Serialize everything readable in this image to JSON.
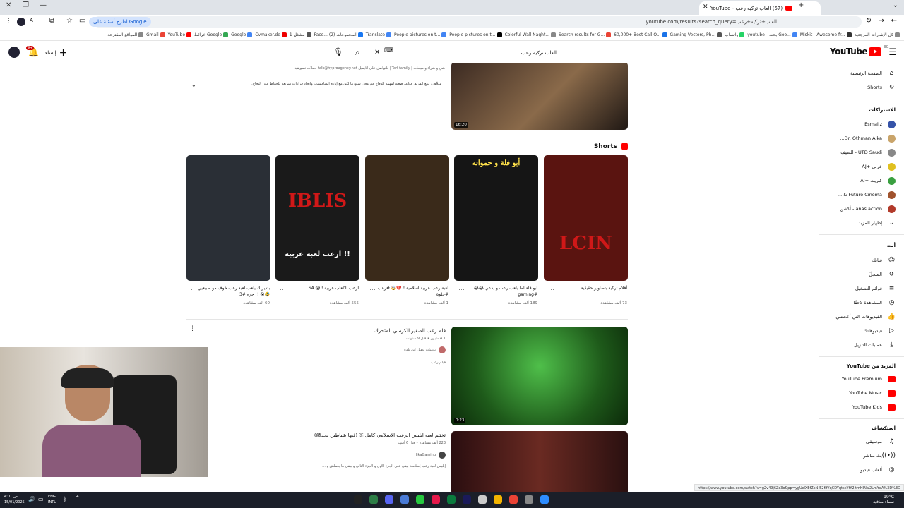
{
  "browser": {
    "tab_title": "(57) العاب تركيه رعب - YouTube",
    "url": "youtube.com/results?search_query=العاب+تركيه+رعب",
    "google_chip": "اطرح أسئلة على Google",
    "bookmarks": [
      "كل الإشارات المرجعية",
      "Miskit - Awesome fr...",
      "youtube - بحث Goo...",
      "واتساب",
      "Gaming Vectors, Ph...",
      "60,000+ Best Call O...",
      "Search results for G...",
      "Colorful Wall Naght...",
      "People pictures on t...",
      "People pictures on t...",
      "Translate",
      "Face... (2) المجموعات",
      "مشغل 1",
      "Cvmaker.de",
      "Google",
      "خرائط Google",
      "YouTube",
      "Gmail",
      "المواقع المقترحة"
    ]
  },
  "header": {
    "logo_text": "YouTube",
    "logo_region": "EG",
    "search_value": "العاب تركيه رعب",
    "create_label": "إنشاء",
    "notif_count": "9+"
  },
  "sidebar": {
    "home": "الصفحة الرئيسية",
    "shorts": "Shorts",
    "subs_header": "الاشتراكات",
    "subs": [
      {
        "name": "Esmailz",
        "color": "#3553a8"
      },
      {
        "name": "Dr. Othman Alka...",
        "color": "#c9a46a"
      },
      {
        "name": "UTD Saudi - السيف",
        "color": "#888888"
      },
      {
        "name": "عربي +AJ",
        "color": "#e0c020"
      },
      {
        "name": "كبريت +AJ",
        "color": "#3aa040"
      },
      {
        "name": "Future Cinema & ...",
        "color": "#a0522d"
      },
      {
        "name": "anas action - أكشن",
        "color": "#b23a2a"
      }
    ],
    "show_more": "إظهار المزيد",
    "you_header": "أنت",
    "you_items": [
      "قناتك",
      "السجلّ",
      "قوائم التشغيل",
      "المشاهدة لاحقًا",
      "الفيديوهات التي أعجبتني",
      "فيديوهاتك",
      "عمليات التنزيل"
    ],
    "more_from_header": "المزيد من YouTube",
    "more_from": [
      "YouTube Premium",
      "YouTube Music",
      "YouTube Kids"
    ],
    "explore_header": "استكشاف",
    "explore": [
      "موسيقى",
      "بث مباشر",
      "ألعاب فيديو"
    ]
  },
  "main": {
    "top_video": {
      "desc": "شي و شراء و مبيعات | Tarl family | للتواصل على الايميل talk@hyproagency.net حملات تسويقية",
      "ad_text": "ملخّص: يتبع الفريق قواعد صعبة لمهمة الدفاع في محل شاورما لكن مع إثارة المنافسين، واتخاذ قرارات سريعة للحفاظ على النجاح.",
      "duration": "16:20"
    },
    "shorts_header": "Shorts",
    "shorts": [
      {
        "title": "أفلام تركية بتصاوير حقيقية",
        "views": "73 ألف مشاهدة",
        "bg": "#5a1410",
        "overlay": "LCIN"
      },
      {
        "title": "ابو فلة لما يلعب رعب و يدعي 😂😂 #gaming",
        "views": "189 ألف مشاهدة",
        "bg": "#151515",
        "overlay": "أبو فلة و حمواته"
      },
      {
        "title": "لعبة رعب عربية اسلامية ! 💔🤯 #رعب #حلوة",
        "views": "1 ألف مشاهدة",
        "bg": "#3a2a1a",
        "overlay": ""
      },
      {
        "title": "ارعب الالعاب عربية ! 😱 SA",
        "views": "555 ألف مشاهدة",
        "bg": "#1a1a1a",
        "overlay": "IBLIS"
      },
      {
        "title": "بتديريك يلعب لعبة رعب خوف مو طبيعيي 🤣😰 !! جزء #3",
        "views": "60 ألف مشاهدة",
        "bg": "#2a2f36",
        "overlay": ""
      }
    ],
    "shorts_overlay_sub": "ارعب لعبة عربية !!",
    "video2": {
      "title": "فلم رعب الصغير الكرسي المتحرك",
      "meta": "4.1 مليون • قبل 9 سنوات",
      "channel": "يوميات عقيل ابن بلده",
      "badge": "فيلم رعب",
      "duration": "0:23"
    },
    "video3": {
      "title": "تختيم لعبه ابليس الرعب الاسلامي كامل 🇸 (فيها شياطين بجد😱)",
      "meta": "223 ألف مشاهدة • قبل 6 أشهر",
      "channel": "HikaGaming",
      "desc": "إبليس لعبة رعب إسلامية بيقي علي الجزء الأول و الجزء الثاني و بيقي ما يعملش و ..."
    }
  },
  "taskbar": {
    "weather": "19°C",
    "weather_desc": "سماء صافية",
    "lang": "ENG",
    "lang2": "INTL",
    "time": "4:01 ص",
    "date": "15/01/2025"
  },
  "status_url": "https://www.youtube.com/watch?v=g2v49j6Zc3o&pp=ygUcIXEfZkN-52KfYqCDYqtsxYfY2ItmHINw2LmYqA%3D%3D"
}
